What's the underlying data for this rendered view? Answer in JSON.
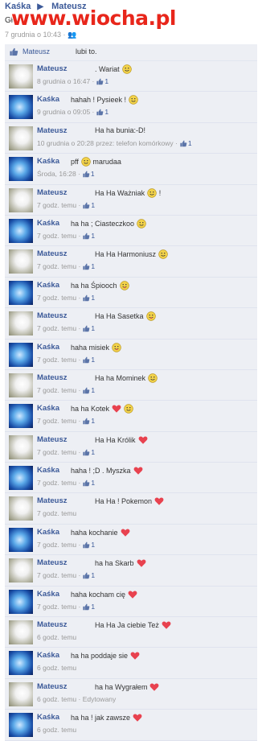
{
  "header": {
    "name_from": "Kaśka",
    "name_to": "Mateusz",
    "subtitle": "Gł",
    "date": "7 grudnia o 10:43 ·",
    "watermark": "www.wiocha.pl"
  },
  "likebar": {
    "who": "Mateusz",
    "text": "lubi to."
  },
  "posts": [
    {
      "author": "Mateusz",
      "text": ". Wariat",
      "emoji": [
        "smile"
      ],
      "meta": "8 grudnia o 16:47 ·",
      "likes": "1"
    },
    {
      "author": "Kaśka",
      "text": "hahah ! Pysieek !",
      "emoji": [
        "smile"
      ],
      "meta": "9 grudnia o 09:05 ·",
      "likes": "1"
    },
    {
      "author": "Mateusz",
      "text": "Ha ha bunia:-D!",
      "emoji": [],
      "meta": "10 grudnia o 20:28 przez: telefon komórkowy ·",
      "likes": "1"
    },
    {
      "author": "Kaśka",
      "text": "pff",
      "emoji": [
        "smile"
      ],
      "text2": "marudaa",
      "meta": "Środa, 16:28 ·",
      "likes": "1"
    },
    {
      "author": "Mateusz",
      "text": "Ha Ha Ważniak",
      "emoji": [
        "smile"
      ],
      "text2": "!",
      "meta": "7 godz. temu ·",
      "likes": "1"
    },
    {
      "author": "Kaśka",
      "text": "ha ha ; Ciasteczkoo",
      "emoji": [
        "smile"
      ],
      "meta": "7 godz. temu ·",
      "likes": "1"
    },
    {
      "author": "Mateusz",
      "text": "Ha Ha Harmoniusz",
      "emoji": [
        "smile"
      ],
      "meta": "7 godz. temu ·",
      "likes": "1"
    },
    {
      "author": "Kaśka",
      "text": "ha ha Śpiooch",
      "emoji": [
        "tongue"
      ],
      "meta": "7 godz. temu ·",
      "likes": "1"
    },
    {
      "author": "Mateusz",
      "text": "Ha Ha Sasetka",
      "emoji": [
        "tongue"
      ],
      "meta": "7 godz. temu ·",
      "likes": "1"
    },
    {
      "author": "Kaśka",
      "text": "haha misiek",
      "emoji": [
        "tongue"
      ],
      "meta": "7 godz. temu ·",
      "likes": "1"
    },
    {
      "author": "Mateusz",
      "text": "Ha ha Mominek",
      "emoji": [
        "smile"
      ],
      "meta": "7 godz. temu ·",
      "likes": "1"
    },
    {
      "author": "Kaśka",
      "text": "ha ha Kotek",
      "emoji": [
        "heart",
        "smile"
      ],
      "meta": "7 godz. temu ·",
      "likes": "1"
    },
    {
      "author": "Mateusz",
      "text": "Ha Ha Królik",
      "emoji": [
        "heart"
      ],
      "meta": "7 godz. temu ·",
      "likes": "1"
    },
    {
      "author": "Kaśka",
      "text": "haha ! ;D . Myszka",
      "emoji": [
        "heart"
      ],
      "meta": "7 godz. temu ·",
      "likes": "1"
    },
    {
      "author": "Mateusz",
      "text": "Ha Ha ! Pokemon",
      "emoji": [
        "heart"
      ],
      "meta": "7 godz. temu",
      "likes": ""
    },
    {
      "author": "Kaśka",
      "text": "haha kochanie",
      "emoji": [
        "heart"
      ],
      "meta": "7 godz. temu ·",
      "likes": "1"
    },
    {
      "author": "Mateusz",
      "text": "ha ha Skarb",
      "emoji": [
        "heart"
      ],
      "meta": "7 godz. temu ·",
      "likes": "1"
    },
    {
      "author": "Kaśka",
      "text": "haha kocham cię",
      "emoji": [
        "heart"
      ],
      "meta": "7 godz. temu ·",
      "likes": "1"
    },
    {
      "author": "Mateusz",
      "text": "Ha Ha Ja ciebie Też",
      "emoji": [
        "heart"
      ],
      "meta": "6 godz. temu",
      "likes": ""
    },
    {
      "author": "Kaśka",
      "text": "ha ha poddaje sie",
      "emoji": [
        "heart"
      ],
      "meta": "6 godz. temu",
      "likes": ""
    },
    {
      "author": "Mateusz",
      "text": "ha ha Wygrałem",
      "emoji": [
        "heart"
      ],
      "meta": "6 godz. temu · Edytowany",
      "likes": ""
    },
    {
      "author": "Kaśka",
      "text": "ha ha ! jak zawsze",
      "emoji": [
        "heart"
      ],
      "meta": "6 godz. temu",
      "likes": ""
    }
  ],
  "colors": {
    "link": "#3b5998",
    "bg_row": "#edeff4",
    "heart": "#e8424f",
    "smiley": "#f2d24a",
    "watermark": "#e8261b"
  }
}
